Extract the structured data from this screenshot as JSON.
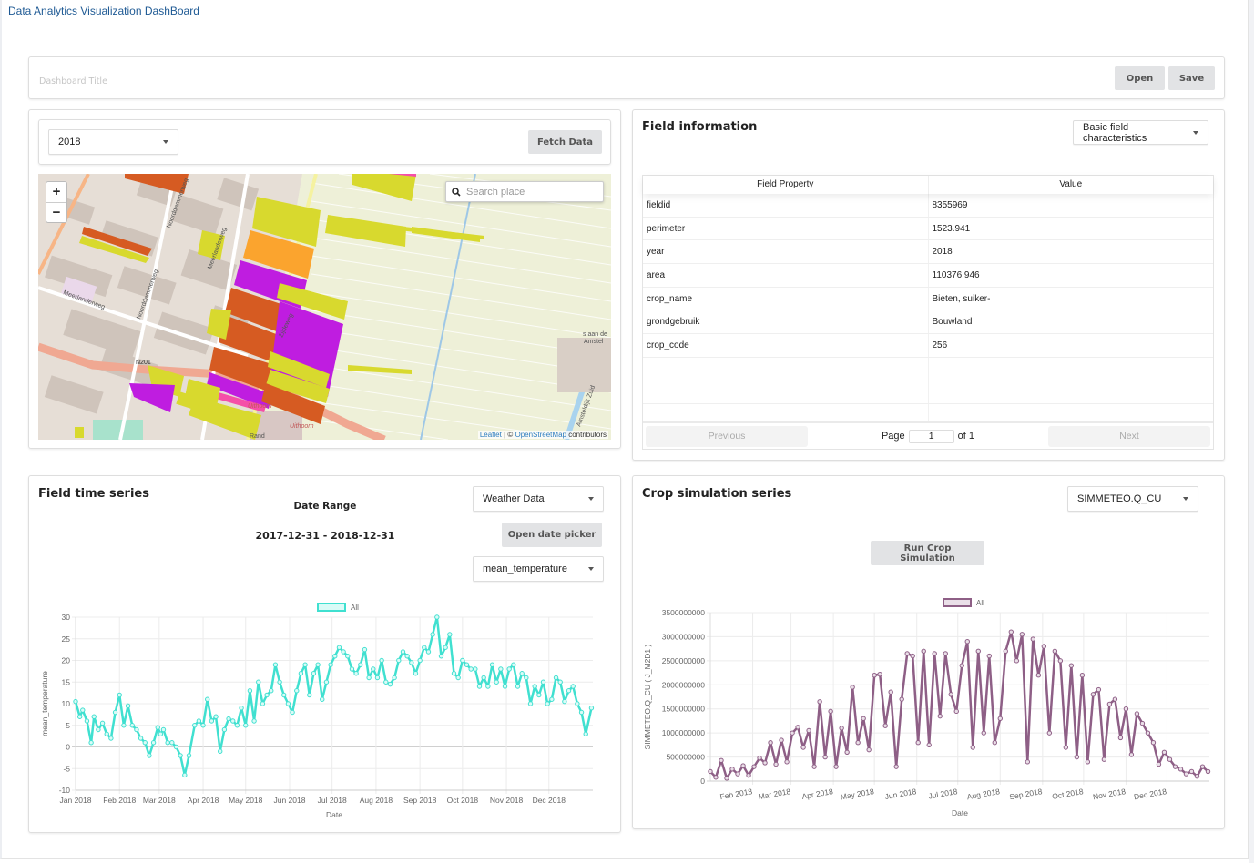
{
  "app": {
    "title": "Data Analytics Visualization DashBoard"
  },
  "header": {
    "title_placeholder": "Dashboard Title",
    "open_label": "Open",
    "save_label": "Save"
  },
  "map_panel": {
    "year_select": "2018",
    "fetch_label": "Fetch Data",
    "zoom_in": "+",
    "zoom_out": "−",
    "search_placeholder": "Search place",
    "search_icon": "search-icon",
    "attribution": {
      "leaflet": "Leaflet",
      "sep": " | © ",
      "osm": "OpenStreetMap",
      "suffix": " contributors"
    },
    "labels": [
      "Meerlanderweg",
      "Noorddammerweg",
      "Meerlanderweg",
      "Noorddammerweg",
      "Zijdeweg",
      "N201",
      "Uithoorn",
      "Uithoorn",
      "Rand",
      "Amsteldijk Zuid",
      "...s aan de Amstel"
    ]
  },
  "field_info": {
    "title": "Field information",
    "select": "Basic field characteristics",
    "columns": [
      "Field Property",
      "Value"
    ],
    "rows": [
      [
        "fieldid",
        "8355969"
      ],
      [
        "perimeter",
        "1523.941"
      ],
      [
        "year",
        "2018"
      ],
      [
        "area",
        "110376.946"
      ],
      [
        "crop_name",
        "Bieten, suiker-"
      ],
      [
        "grondgebruik",
        "Bouwland"
      ],
      [
        "crop_code",
        "256"
      ],
      [
        "",
        ""
      ],
      [
        "",
        ""
      ],
      [
        "",
        ""
      ]
    ],
    "pager": {
      "previous": "Previous",
      "page_label": "Page",
      "page_value": "1",
      "of_label": "of 1",
      "next": "Next"
    }
  },
  "time_series": {
    "title": "Field time series",
    "date_range_label": "Date Range",
    "date_range_value": "2017-12-31 - 2018-12-31",
    "source_select": "Weather Data",
    "date_picker_label": "Open date picker",
    "variable_select": "mean_temperature",
    "colors": {
      "line": "#40e0d0",
      "fill": "#d9fbf7"
    }
  },
  "crop_sim": {
    "title": "Crop simulation series",
    "variable_select": "SIMMETEO.Q_CU",
    "run_label": "Run Crop Simulation",
    "colors": {
      "line": "#8e5f86",
      "fill": "#eadfe8"
    }
  },
  "chart_data": [
    {
      "type": "line",
      "title": "",
      "legend": [
        "All"
      ],
      "legend_position": "top-center",
      "xlabel": "Date",
      "ylabel": "mean_temperature",
      "ylim": [
        -10,
        30
      ],
      "yticks": [
        -10,
        -5,
        0,
        5,
        10,
        15,
        20,
        25,
        30
      ],
      "xticks": [
        "Jan 2018",
        "Feb 2018",
        "Mar 2018",
        "Apr 2018",
        "May 2018",
        "Jun 2018",
        "Jul 2018",
        "Aug 2018",
        "Sep 2018",
        "Oct 2018",
        "Nov 2018",
        "Dec 2018"
      ],
      "x_range_days": [
        0,
        365
      ],
      "grid": true,
      "series": [
        {
          "name": "All",
          "x_day": [
            0,
            3,
            5,
            8,
            11,
            13,
            16,
            19,
            22,
            25,
            28,
            31,
            34,
            37,
            40,
            43,
            46,
            49,
            52,
            55,
            58,
            60,
            62,
            65,
            68,
            71,
            74,
            77,
            80,
            84,
            87,
            90,
            93,
            96,
            99,
            102,
            105,
            108,
            111,
            114,
            117,
            120,
            123,
            126,
            129,
            132,
            135,
            138,
            141,
            144,
            147,
            150,
            153,
            156,
            159,
            162,
            165,
            168,
            171,
            174,
            177,
            180,
            183,
            186,
            189,
            192,
            195,
            198,
            201,
            204,
            207,
            210,
            213,
            216,
            219,
            222,
            225,
            228,
            231,
            234,
            237,
            240,
            243,
            246,
            249,
            252,
            255,
            258,
            261,
            264,
            267,
            270,
            273,
            276,
            279,
            282,
            285,
            288,
            291,
            294,
            297,
            300,
            303,
            306,
            309,
            312,
            315,
            318,
            321,
            324,
            327,
            330,
            333,
            336,
            339,
            342,
            345,
            348,
            351,
            354,
            357,
            360,
            364
          ],
          "values": [
            10.5,
            7,
            8.5,
            6,
            1,
            7,
            4,
            5.5,
            3,
            2,
            8,
            12,
            5,
            9.5,
            5,
            4,
            2,
            1,
            -2,
            1,
            4.5,
            3,
            4,
            1,
            1,
            0,
            -2,
            -6.5,
            -2,
            5,
            6,
            5,
            11,
            6,
            7,
            -1,
            4,
            6.5,
            6,
            5,
            9,
            5,
            13,
            6,
            15,
            10,
            12,
            13,
            19,
            15,
            12,
            10,
            8,
            13,
            17,
            19,
            12,
            17,
            19,
            11,
            15,
            19,
            21,
            23,
            22,
            21,
            18,
            17,
            19,
            22.5,
            16,
            18,
            16,
            20,
            15,
            14.5,
            16,
            20,
            22,
            21,
            19.5,
            17,
            20,
            23,
            22,
            26,
            30,
            21,
            23,
            26,
            17,
            16,
            20,
            19,
            18,
            18,
            14,
            16,
            14,
            19,
            15,
            18,
            14,
            18,
            19,
            14,
            17,
            16,
            10,
            14,
            12,
            15,
            10,
            11,
            16,
            15,
            10.5,
            13,
            14,
            10,
            8,
            3,
            9,
            2,
            6,
            10,
            8,
            6,
            5,
            11,
            8,
            9,
            6,
            3,
            3,
            3,
            3,
            5,
            10,
            11,
            4,
            10,
            6,
            3,
            1,
            0,
            7,
            10,
            8,
            1,
            6,
            9
          ]
        }
      ]
    },
    {
      "type": "line",
      "title": "",
      "legend": [
        "All"
      ],
      "legend_position": "top-center",
      "xlabel": "Date",
      "ylabel": "SIMMETEO.Q_CU ( J_M2D1 )",
      "ylim": [
        0,
        3500000000
      ],
      "yticks": [
        0,
        500000000,
        1000000000,
        1500000000,
        2000000000,
        2500000000,
        3000000000,
        3500000000
      ],
      "xticks": [
        "Feb 2018",
        "Mar 2018",
        "Apr 2018",
        "May 2018",
        "Jun 2018",
        "Jul 2018",
        "Aug 2018",
        "Sep 2018",
        "Oct 2018",
        "Nov 2018",
        "Dec 2018"
      ],
      "x_range_days": [
        0,
        365
      ],
      "grid": true,
      "series": [
        {
          "name": "All",
          "x_day": [
            0,
            4,
            8,
            12,
            16,
            20,
            24,
            28,
            32,
            36,
            40,
            44,
            48,
            52,
            56,
            60,
            64,
            68,
            72,
            76,
            80,
            84,
            88,
            92,
            96,
            100,
            104,
            108,
            112,
            116,
            120,
            124,
            128,
            132,
            136,
            140,
            144,
            148,
            152,
            156,
            160,
            164,
            168,
            172,
            176,
            180,
            184,
            188,
            192,
            196,
            200,
            204,
            208,
            212,
            216,
            220,
            224,
            228,
            232,
            236,
            240,
            244,
            248,
            252,
            256,
            260,
            264,
            268,
            272,
            276,
            280,
            284,
            288,
            292,
            296,
            300,
            304,
            308,
            312,
            316,
            320,
            324,
            328,
            332,
            336,
            340,
            344,
            348,
            352,
            356,
            360,
            364
          ],
          "values": [
            200000000,
            80000000,
            430000000,
            60000000,
            250000000,
            150000000,
            320000000,
            120000000,
            300000000,
            480000000,
            380000000,
            800000000,
            350000000,
            850000000,
            400000000,
            1000000000,
            1120000000,
            700000000,
            1050000000,
            300000000,
            1650000000,
            500000000,
            1450000000,
            300000000,
            1100000000,
            600000000,
            1950000000,
            800000000,
            1300000000,
            650000000,
            2200000000,
            2220000000,
            1150000000,
            1850000000,
            300000000,
            1700000000,
            2650000000,
            2600000000,
            800000000,
            2700000000,
            750000000,
            2650000000,
            1350000000,
            2650000000,
            1800000000,
            1450000000,
            2400000000,
            2900000000,
            700000000,
            2700000000,
            1000000000,
            2600000000,
            800000000,
            1300000000,
            2700000000,
            3100000000,
            2500000000,
            3050000000,
            400000000,
            2950000000,
            2200000000,
            2800000000,
            1000000000,
            2700000000,
            2500000000,
            700000000,
            2400000000,
            500000000,
            2200000000,
            400000000,
            1800000000,
            1900000000,
            450000000,
            1600000000,
            1700000000,
            900000000,
            1500000000,
            550000000,
            1400000000,
            1200000000,
            1000000000,
            800000000,
            350000000,
            600000000,
            450000000,
            300000000,
            250000000,
            150000000,
            200000000,
            100000000,
            300000000,
            200000000
          ]
        }
      ]
    }
  ]
}
